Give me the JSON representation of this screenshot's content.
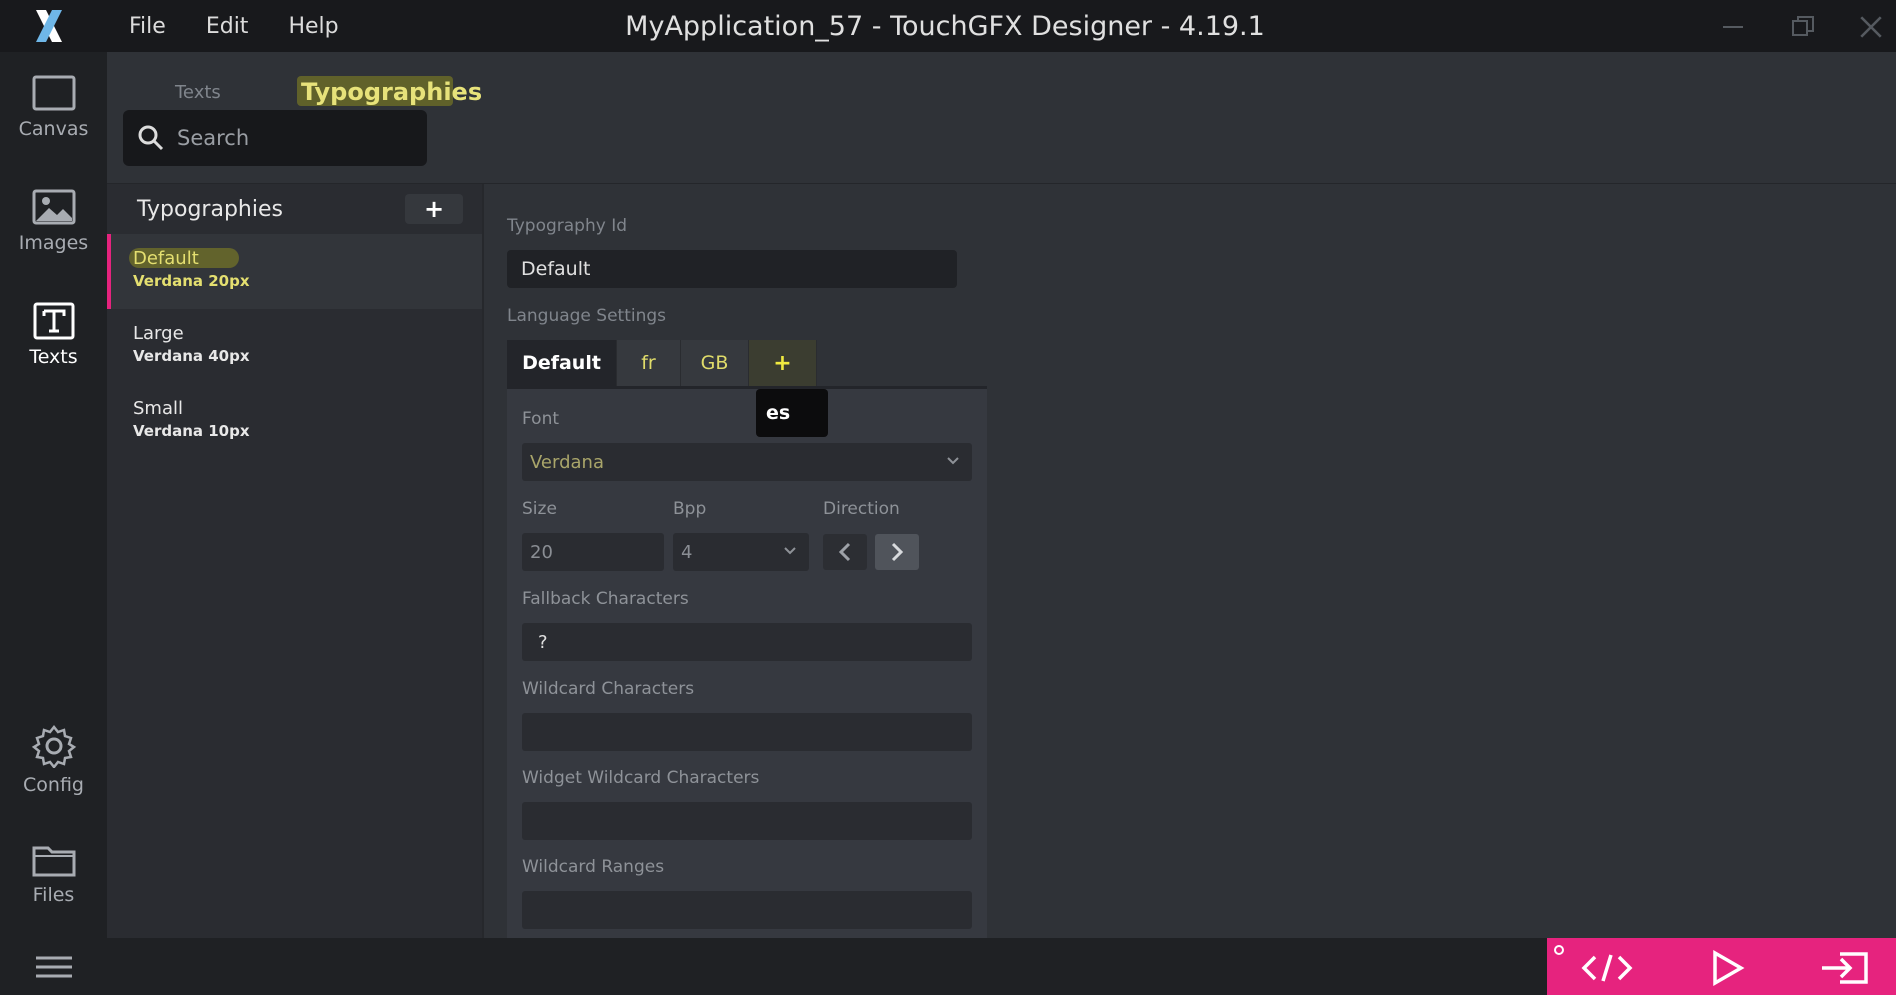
{
  "titlebar": {
    "app_title": "MyApplication_57 - TouchGFX Designer - 4.19.1",
    "menu": [
      "File",
      "Edit",
      "Help"
    ]
  },
  "sidebar": {
    "items": [
      {
        "label": "Canvas",
        "icon": "canvas-icon"
      },
      {
        "label": "Images",
        "icon": "image-icon"
      },
      {
        "label": "Texts",
        "icon": "text-icon"
      },
      {
        "label": "Config",
        "icon": "gear-icon"
      },
      {
        "label": "Files",
        "icon": "folder-icon"
      }
    ],
    "active": "Texts"
  },
  "tabs": {
    "texts": "Texts",
    "typographies": "Typographies"
  },
  "search": {
    "placeholder": "Search"
  },
  "typo_list": {
    "title": "Typographies",
    "add_label": "+",
    "items": [
      {
        "name": "Default",
        "sub": "Verdana  20px"
      },
      {
        "name": "Large",
        "sub": "Verdana  40px"
      },
      {
        "name": "Small",
        "sub": "Verdana  10px"
      }
    ]
  },
  "detail": {
    "typography_id_label": "Typography Id",
    "typography_id_value": "Default",
    "language_settings_label": "Language Settings",
    "lang_tabs": [
      "Default",
      "fr",
      "GB",
      "+"
    ],
    "tooltip": "es",
    "font_label": "Font",
    "font_value": "Verdana",
    "size_label": "Size",
    "size_value": "20",
    "bpp_label": "Bpp",
    "bpp_value": "4",
    "direction_label": "Direction",
    "fallback_label": "Fallback Characters",
    "fallback_value": "?",
    "wildcard_label": "Wildcard Characters",
    "widget_wildcard_label": "Widget Wildcard Characters",
    "wildcard_ranges_label": "Wildcard Ranges"
  },
  "colors": {
    "accent": "#e6237e",
    "highlight": "#e4df70",
    "background": "#2f3237"
  }
}
